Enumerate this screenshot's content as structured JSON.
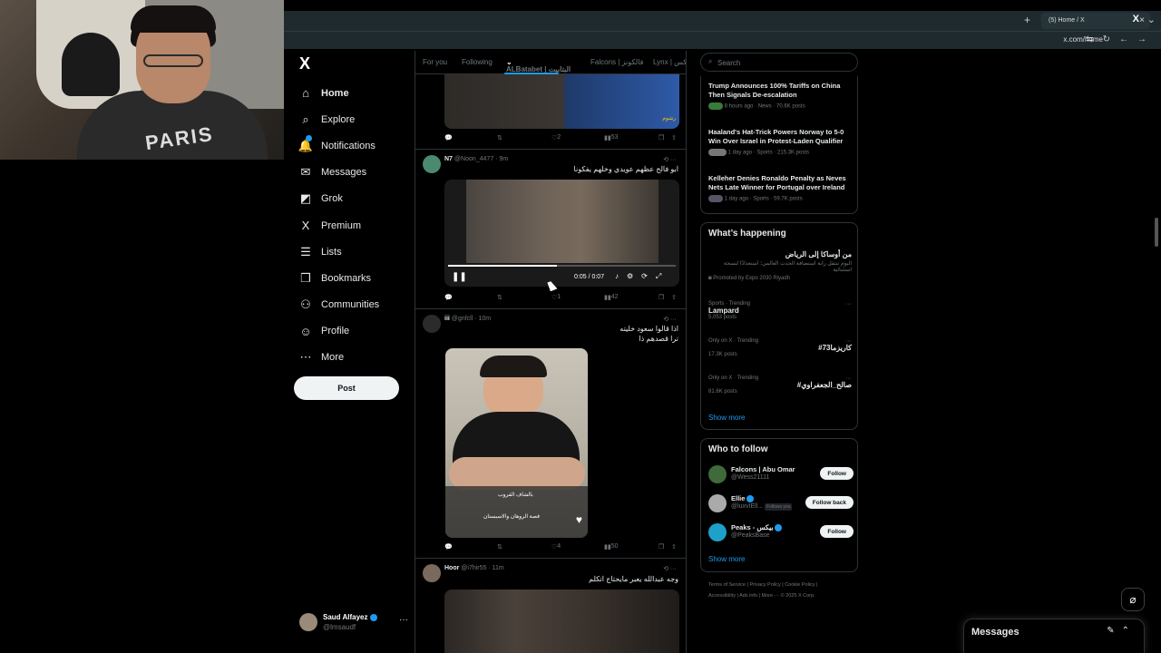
{
  "browser": {
    "tab_title": "(5) Home / X",
    "url": "x.com/home",
    "new_tab_icon": "+",
    "close_icon": "×"
  },
  "webcam": {
    "shirt_text": "PARIS"
  },
  "nav": {
    "logo": "X",
    "items": [
      {
        "label": "Home",
        "icon": "⌂"
      },
      {
        "label": "Explore",
        "icon": "⌕"
      },
      {
        "label": "Notifications",
        "icon": "🔔"
      },
      {
        "label": "Messages",
        "icon": "✉"
      },
      {
        "label": "Grok",
        "icon": "◩"
      },
      {
        "label": "Premium",
        "icon": "X"
      },
      {
        "label": "Lists",
        "icon": "☰"
      },
      {
        "label": "Bookmarks",
        "icon": "❒"
      },
      {
        "label": "Communities",
        "icon": "⚇"
      },
      {
        "label": "Profile",
        "icon": "☺"
      },
      {
        "label": "More",
        "icon": "⋯"
      }
    ],
    "post_label": "Post",
    "account": {
      "name": "Saud Alfayez",
      "handle": "@lmsaudf",
      "more": "···"
    }
  },
  "timeline": {
    "tabs": [
      "For you",
      "Following",
      "ALBatabet | البتابيت",
      "Falcons | فالكونز",
      "Lynx | لينكس"
    ],
    "tweets": [
      {
        "replies": "",
        "reposts": "",
        "likes": "2",
        "views": "53",
        "media_caption": "رشوم"
      },
      {
        "name": "N7",
        "handle": "@Noon_4477",
        "time": "9m",
        "text": "ابو فالح عظهم عويدي وخلهم يفكونا",
        "video_time": "0:05 / 0:07",
        "likes": "1",
        "views": "42"
      },
      {
        "name": "iii",
        "handle": "@gnfcll",
        "time": "10m",
        "text_line1": "اذا قالوا سعود خليته",
        "text_line2": "ترا قصدهم ذا",
        "overlay_top": "بالشاف القروب",
        "overlay_bottom": "قصة الروهان والاسيستان",
        "likes": "4",
        "views": "50"
      },
      {
        "name": "Hoor",
        "handle": "@i7hir55",
        "time": "11m",
        "text": "وجه عبدالله يعبر مايحتاج اتكلم"
      }
    ]
  },
  "right": {
    "search_placeholder": "Search",
    "news": [
      {
        "title": "Trump Announces 100% Tariffs on China Then Signals De-escalation",
        "meta": "8 hours ago · News · 70.6K posts"
      },
      {
        "title": "Haaland's Hat-Trick Powers Norway to 5-0 Win Over Israel in Protest-Laden Qualifier",
        "meta": "1 day ago · Sports · 215.3K posts"
      },
      {
        "title": "Kelleher Denies Ronaldo Penalty as Neves Nets Late Winner for Portugal over Ireland",
        "meta": "1 day ago · Sports · 59.7K posts"
      }
    ],
    "happening": {
      "title": "What’s happening",
      "promo_title": "من أوساكا إلى الرياض",
      "promo_body": "اليوم تنتقل راية استضافة الحدث العالمي؛ استعدادًا لنسخة استثنائية",
      "promo_by": "Promoted by Expo 2030 Riyadh",
      "trends": [
        {
          "ctx": "Sports · Trending",
          "name": "Lampard",
          "count": "5,053 posts"
        },
        {
          "ctx": "Only on X · Trending",
          "name": "#كاريزما73",
          "count": "17.3K posts"
        },
        {
          "ctx": "Only on X · Trending",
          "name": "#صالح_الجعفراوي",
          "count": "81.6K posts"
        }
      ],
      "show_more": "Show more"
    },
    "who_to_follow": {
      "title": "Who to follow",
      "people": [
        {
          "name": "Falcons | Abu Omar",
          "handle": "@Wess21111",
          "button": "Follow",
          "color": "#3f6b3a"
        },
        {
          "name": "Ellie",
          "handle": "@luxvIEll...",
          "follows_you": "Follows you",
          "button": "Follow back",
          "color": "#aaa"
        },
        {
          "name": "Peaks - بيكس",
          "handle": "@PeaksBase",
          "button": "Follow",
          "color": "#1da1c8"
        }
      ],
      "show_more": "Show more"
    },
    "footer": [
      "Terms of Service",
      "Privacy Policy",
      "Cookie Policy",
      "Accessibility",
      "Ads info",
      "More ···",
      "© 2025 X Corp."
    ]
  },
  "messages_dock": {
    "title": "Messages"
  }
}
